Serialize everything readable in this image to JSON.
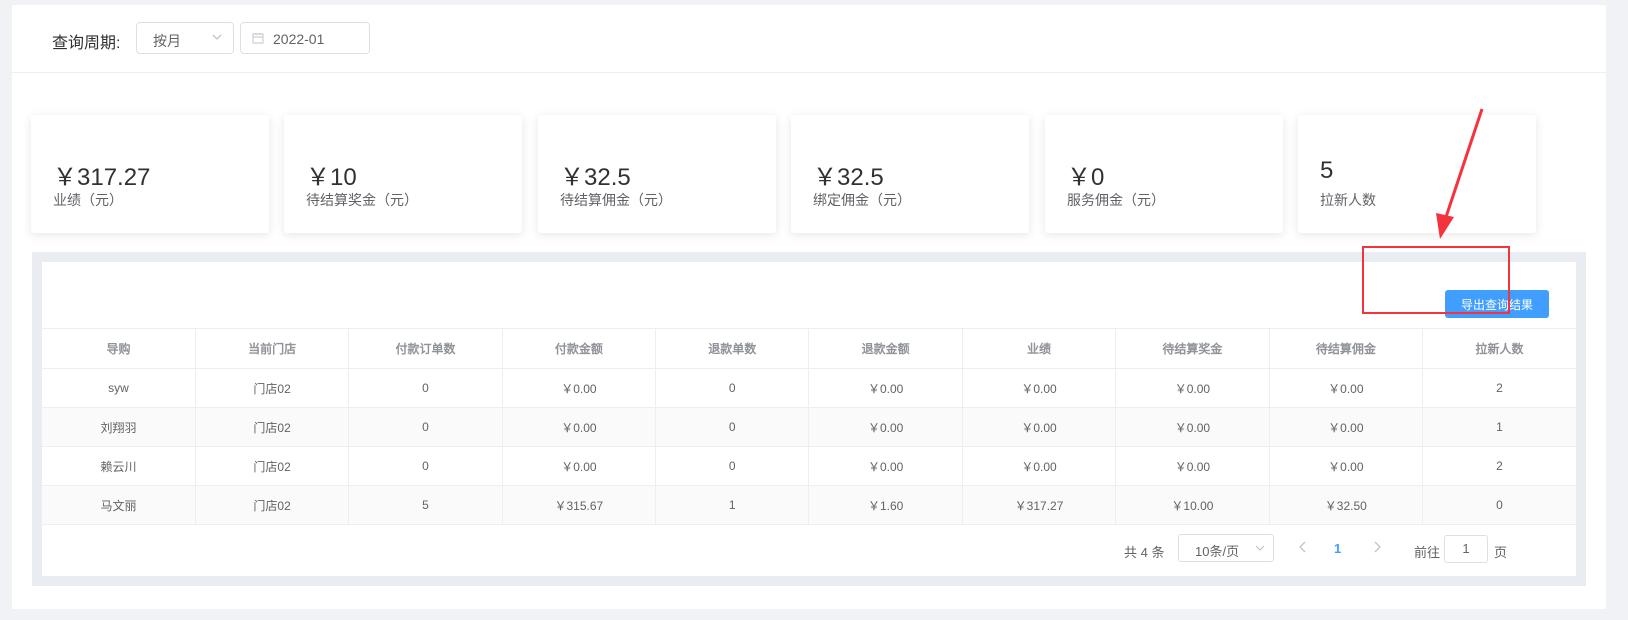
{
  "filter": {
    "label": "查询周期:",
    "period_select": "按月",
    "date_value": "2022-01"
  },
  "stats": [
    {
      "value": "￥317.27",
      "label": "业绩（元）"
    },
    {
      "value": "￥10",
      "label": "待结算奖金（元）"
    },
    {
      "value": "￥32.5",
      "label": "待结算佣金（元）"
    },
    {
      "value": "￥32.5",
      "label": "绑定佣金（元）"
    },
    {
      "value": "￥0",
      "label": "服务佣金（元）"
    },
    {
      "value": "5",
      "label": "拉新人数"
    }
  ],
  "export_label": "导出查询结果",
  "table": {
    "headers": [
      "导购",
      "当前门店",
      "付款订单数",
      "付款金额",
      "退款单数",
      "退款金额",
      "业绩",
      "待结算奖金",
      "待结算佣金",
      "拉新人数"
    ],
    "rows": [
      [
        "syw",
        "门店02",
        "0",
        "￥0.00",
        "0",
        "￥0.00",
        "￥0.00",
        "￥0.00",
        "￥0.00",
        "2"
      ],
      [
        "刘翔羽",
        "门店02",
        "0",
        "￥0.00",
        "0",
        "￥0.00",
        "￥0.00",
        "￥0.00",
        "￥0.00",
        "1"
      ],
      [
        "赖云川",
        "门店02",
        "0",
        "￥0.00",
        "0",
        "￥0.00",
        "￥0.00",
        "￥0.00",
        "￥0.00",
        "2"
      ],
      [
        "马文丽",
        "门店02",
        "5",
        "￥315.67",
        "1",
        "￥1.60",
        "￥317.27",
        "￥10.00",
        "￥32.50",
        "0"
      ]
    ]
  },
  "pagination": {
    "total": "共 4 条",
    "page_size": "10条/页",
    "current_page": "1",
    "goto_label": "前往",
    "goto_value": "1",
    "page_unit": "页"
  },
  "colors": {
    "primary": "#409eff",
    "annotation_red": "#f4333c"
  }
}
